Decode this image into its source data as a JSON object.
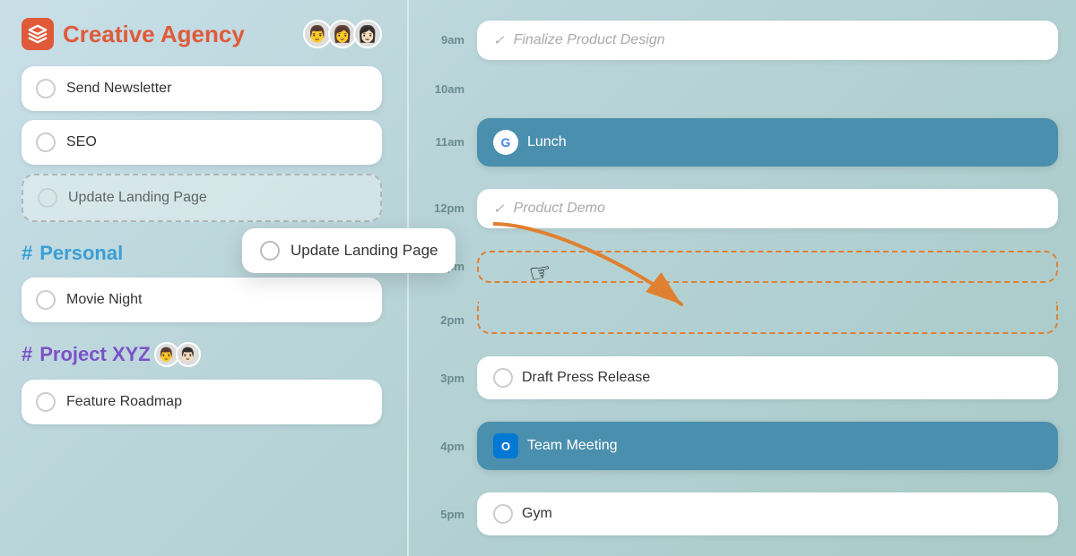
{
  "left": {
    "project": {
      "title": "Creative Agency",
      "icon_label": "layers-icon"
    },
    "tasks": [
      {
        "id": "send-newsletter",
        "label": "Send Newsletter",
        "dashed": false
      },
      {
        "id": "seo",
        "label": "SEO",
        "dashed": false
      },
      {
        "id": "update-landing",
        "label": "Update Landing Page",
        "dashed": true
      }
    ],
    "personal": {
      "section_label": "Personal",
      "tasks": [
        {
          "id": "movie-night",
          "label": "Movie Night"
        }
      ]
    },
    "project_xyz": {
      "section_label": "Project XYZ",
      "tasks": [
        {
          "id": "feature-roadmap",
          "label": "Feature Roadmap"
        }
      ]
    }
  },
  "floating": {
    "label": "Update Landing Page"
  },
  "right": {
    "timeline": [
      {
        "time": "9am",
        "type": "completed",
        "label": "Finalize Product Design"
      },
      {
        "time": "10am",
        "type": "empty",
        "label": ""
      },
      {
        "time": "11am",
        "type": "active",
        "label": "Lunch",
        "icon": "google"
      },
      {
        "time": "12pm",
        "type": "completed",
        "label": "Product Demo"
      },
      {
        "time": "1pm",
        "type": "dashed",
        "label": ""
      },
      {
        "time": "2pm",
        "type": "dashed2",
        "label": ""
      },
      {
        "time": "3pm",
        "type": "plain",
        "label": "Draft Press Release",
        "icon": "checkbox"
      },
      {
        "time": "4pm",
        "type": "active",
        "label": "Team Meeting",
        "icon": "outlook"
      },
      {
        "time": "5pm",
        "type": "plain",
        "label": "Gym",
        "icon": "checkbox"
      }
    ]
  }
}
